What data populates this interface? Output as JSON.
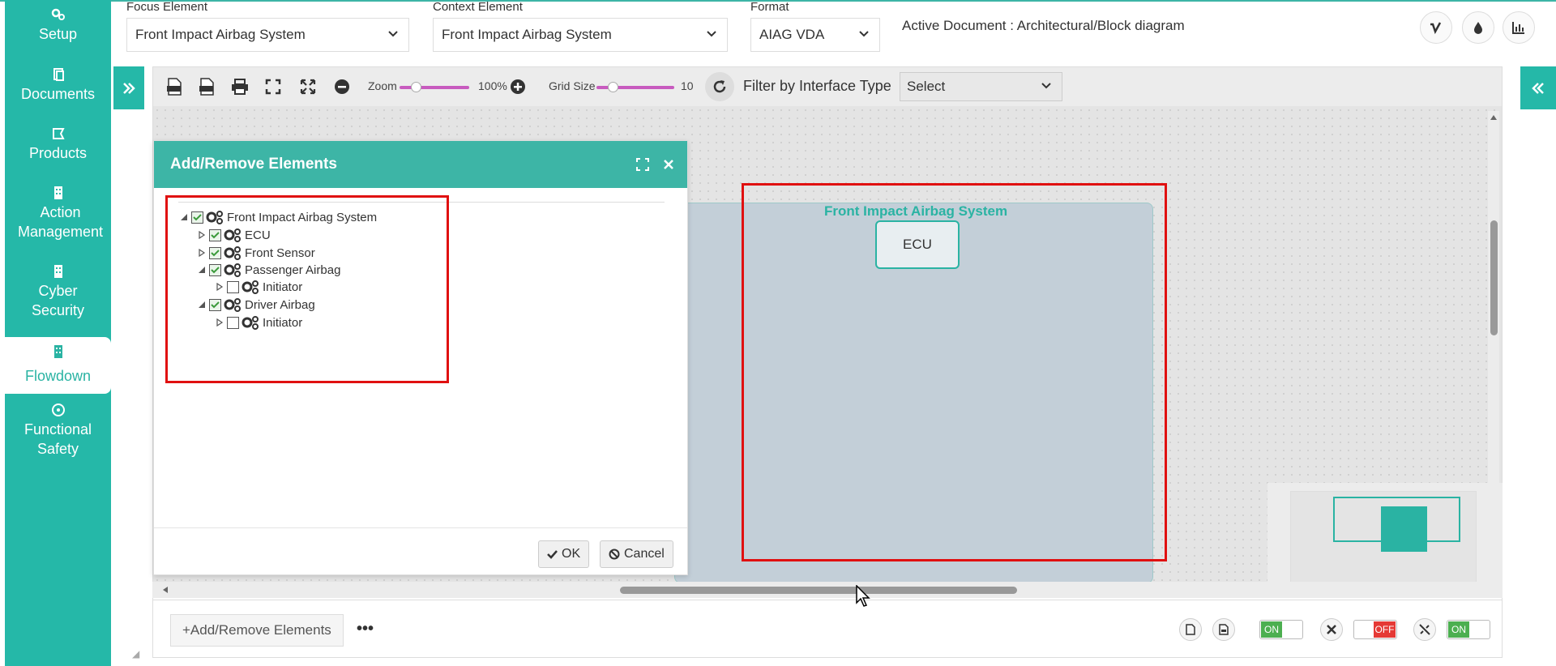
{
  "sidebar": {
    "items": [
      {
        "label": "Setup",
        "icon": "gears-icon"
      },
      {
        "label": "Documents",
        "icon": "documents-icon"
      },
      {
        "label": "Products",
        "icon": "products-icon"
      },
      {
        "label": "Action Management",
        "icon": "building-icon"
      },
      {
        "label": "Cyber Security",
        "icon": "building-icon"
      },
      {
        "label": "Flowdown",
        "icon": "building-icon",
        "active": true
      },
      {
        "label": "Functional Safety",
        "icon": "radiation-icon"
      }
    ]
  },
  "header": {
    "focus_label": "Focus Element",
    "focus_value": "Front Impact Airbag System",
    "context_label": "Context Element",
    "context_value": "Front Impact Airbag System",
    "format_label": "Format",
    "format_value": "AIAG VDA",
    "active_document": "Active Document : Architectural/Block diagram"
  },
  "toolbar": {
    "zoom_label": "Zoom",
    "zoom_value": "100%",
    "grid_label": "Grid Size",
    "grid_value": "10",
    "filter_label": "Filter by Interface Type",
    "filter_value": "Select"
  },
  "diagram": {
    "system_title": "Front Impact Airbag System",
    "ecu_label": "ECU"
  },
  "dialog": {
    "title": "Add/Remove Elements",
    "tree": [
      {
        "label": "Front Impact Airbag System",
        "checked": true
      },
      {
        "label": "ECU",
        "checked": true
      },
      {
        "label": "Front Sensor",
        "checked": true
      },
      {
        "label": "Passenger Airbag",
        "checked": true
      },
      {
        "label": "Initiator",
        "checked": false
      },
      {
        "label": "Driver Airbag",
        "checked": true
      },
      {
        "label": "Initiator",
        "checked": false
      }
    ],
    "ok_label": "OK",
    "cancel_label": "Cancel"
  },
  "bottom": {
    "add_remove_label": "+Add/Remove Elements",
    "more_label": "•••",
    "toggle1": "ON",
    "toggle2": "OFF",
    "toggle3": "ON"
  },
  "colors": {
    "accent": "#25b8a8",
    "highlight": "#e01010"
  }
}
